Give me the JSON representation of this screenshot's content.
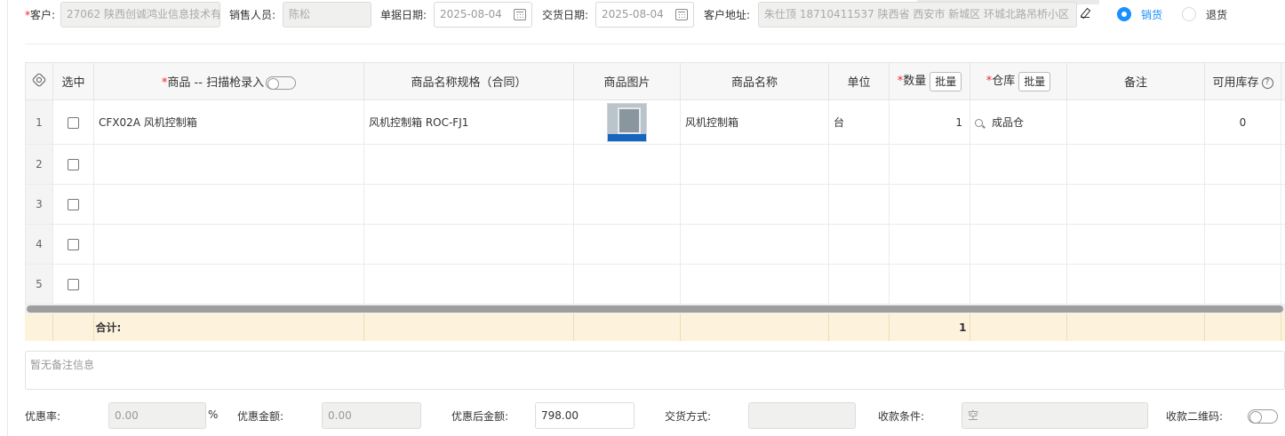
{
  "header": {
    "customer_label": "客户:",
    "customer_value": "27062 陕西创诚鸿业信息技术有",
    "salesperson_label": "销售人员:",
    "salesperson_value": "陈松",
    "order_date_label": "单据日期:",
    "order_date_value": "2025-08-04",
    "delivery_date_label": "交货日期:",
    "delivery_date_value": "2025-08-04",
    "address_label": "客户地址:",
    "address_value": "朱仕顶 18710411537 陕西省 西安市 新城区 环城北路吊桥小区",
    "radio_sale_label": "销货",
    "radio_return_label": "退货",
    "radio_selected": "销货",
    "accent_color": "#1890ff"
  },
  "table": {
    "columns": {
      "select": "选中",
      "product": "商品 -- 扫描枪录入",
      "spec": "商品名称规格（合同）",
      "image": "商品图片",
      "name": "商品名称",
      "unit": "单位",
      "qty": "数量",
      "warehouse": "仓库",
      "remark": "备注",
      "stock": "可用库存"
    },
    "batch_label": "批量",
    "rows": [
      {
        "index": "1",
        "product": "CFX02A 风机控制箱",
        "spec": "风机控制箱 ROC-FJ1",
        "name": "风机控制箱",
        "unit": "台",
        "qty": "1",
        "warehouse": "成品仓",
        "remark": "",
        "stock": "0"
      },
      {
        "index": "2",
        "product": "",
        "spec": "",
        "name": "",
        "unit": "",
        "qty": "",
        "warehouse": "",
        "remark": "",
        "stock": ""
      },
      {
        "index": "3",
        "product": "",
        "spec": "",
        "name": "",
        "unit": "",
        "qty": "",
        "warehouse": "",
        "remark": "",
        "stock": ""
      },
      {
        "index": "4",
        "product": "",
        "spec": "",
        "name": "",
        "unit": "",
        "qty": "",
        "warehouse": "",
        "remark": "",
        "stock": ""
      },
      {
        "index": "5",
        "product": "",
        "spec": "",
        "name": "",
        "unit": "",
        "qty": "",
        "warehouse": "",
        "remark": "",
        "stock": ""
      }
    ],
    "summary_label": "合计:",
    "summary_qty": "1"
  },
  "remark_placeholder": "暂无备注信息",
  "footer": {
    "discount_rate_label": "优惠率:",
    "discount_rate_value": "0.00",
    "percent": "%",
    "discount_amount_label": "优惠金额:",
    "discount_amount_value": "0.00",
    "after_discount_label": "优惠后金额:",
    "after_discount_value": "798.00",
    "delivery_method_label": "交货方式:",
    "delivery_method_value": "",
    "payment_terms_label": "收款条件:",
    "payment_terms_value": "空",
    "qr_label": "收款二维码:"
  }
}
